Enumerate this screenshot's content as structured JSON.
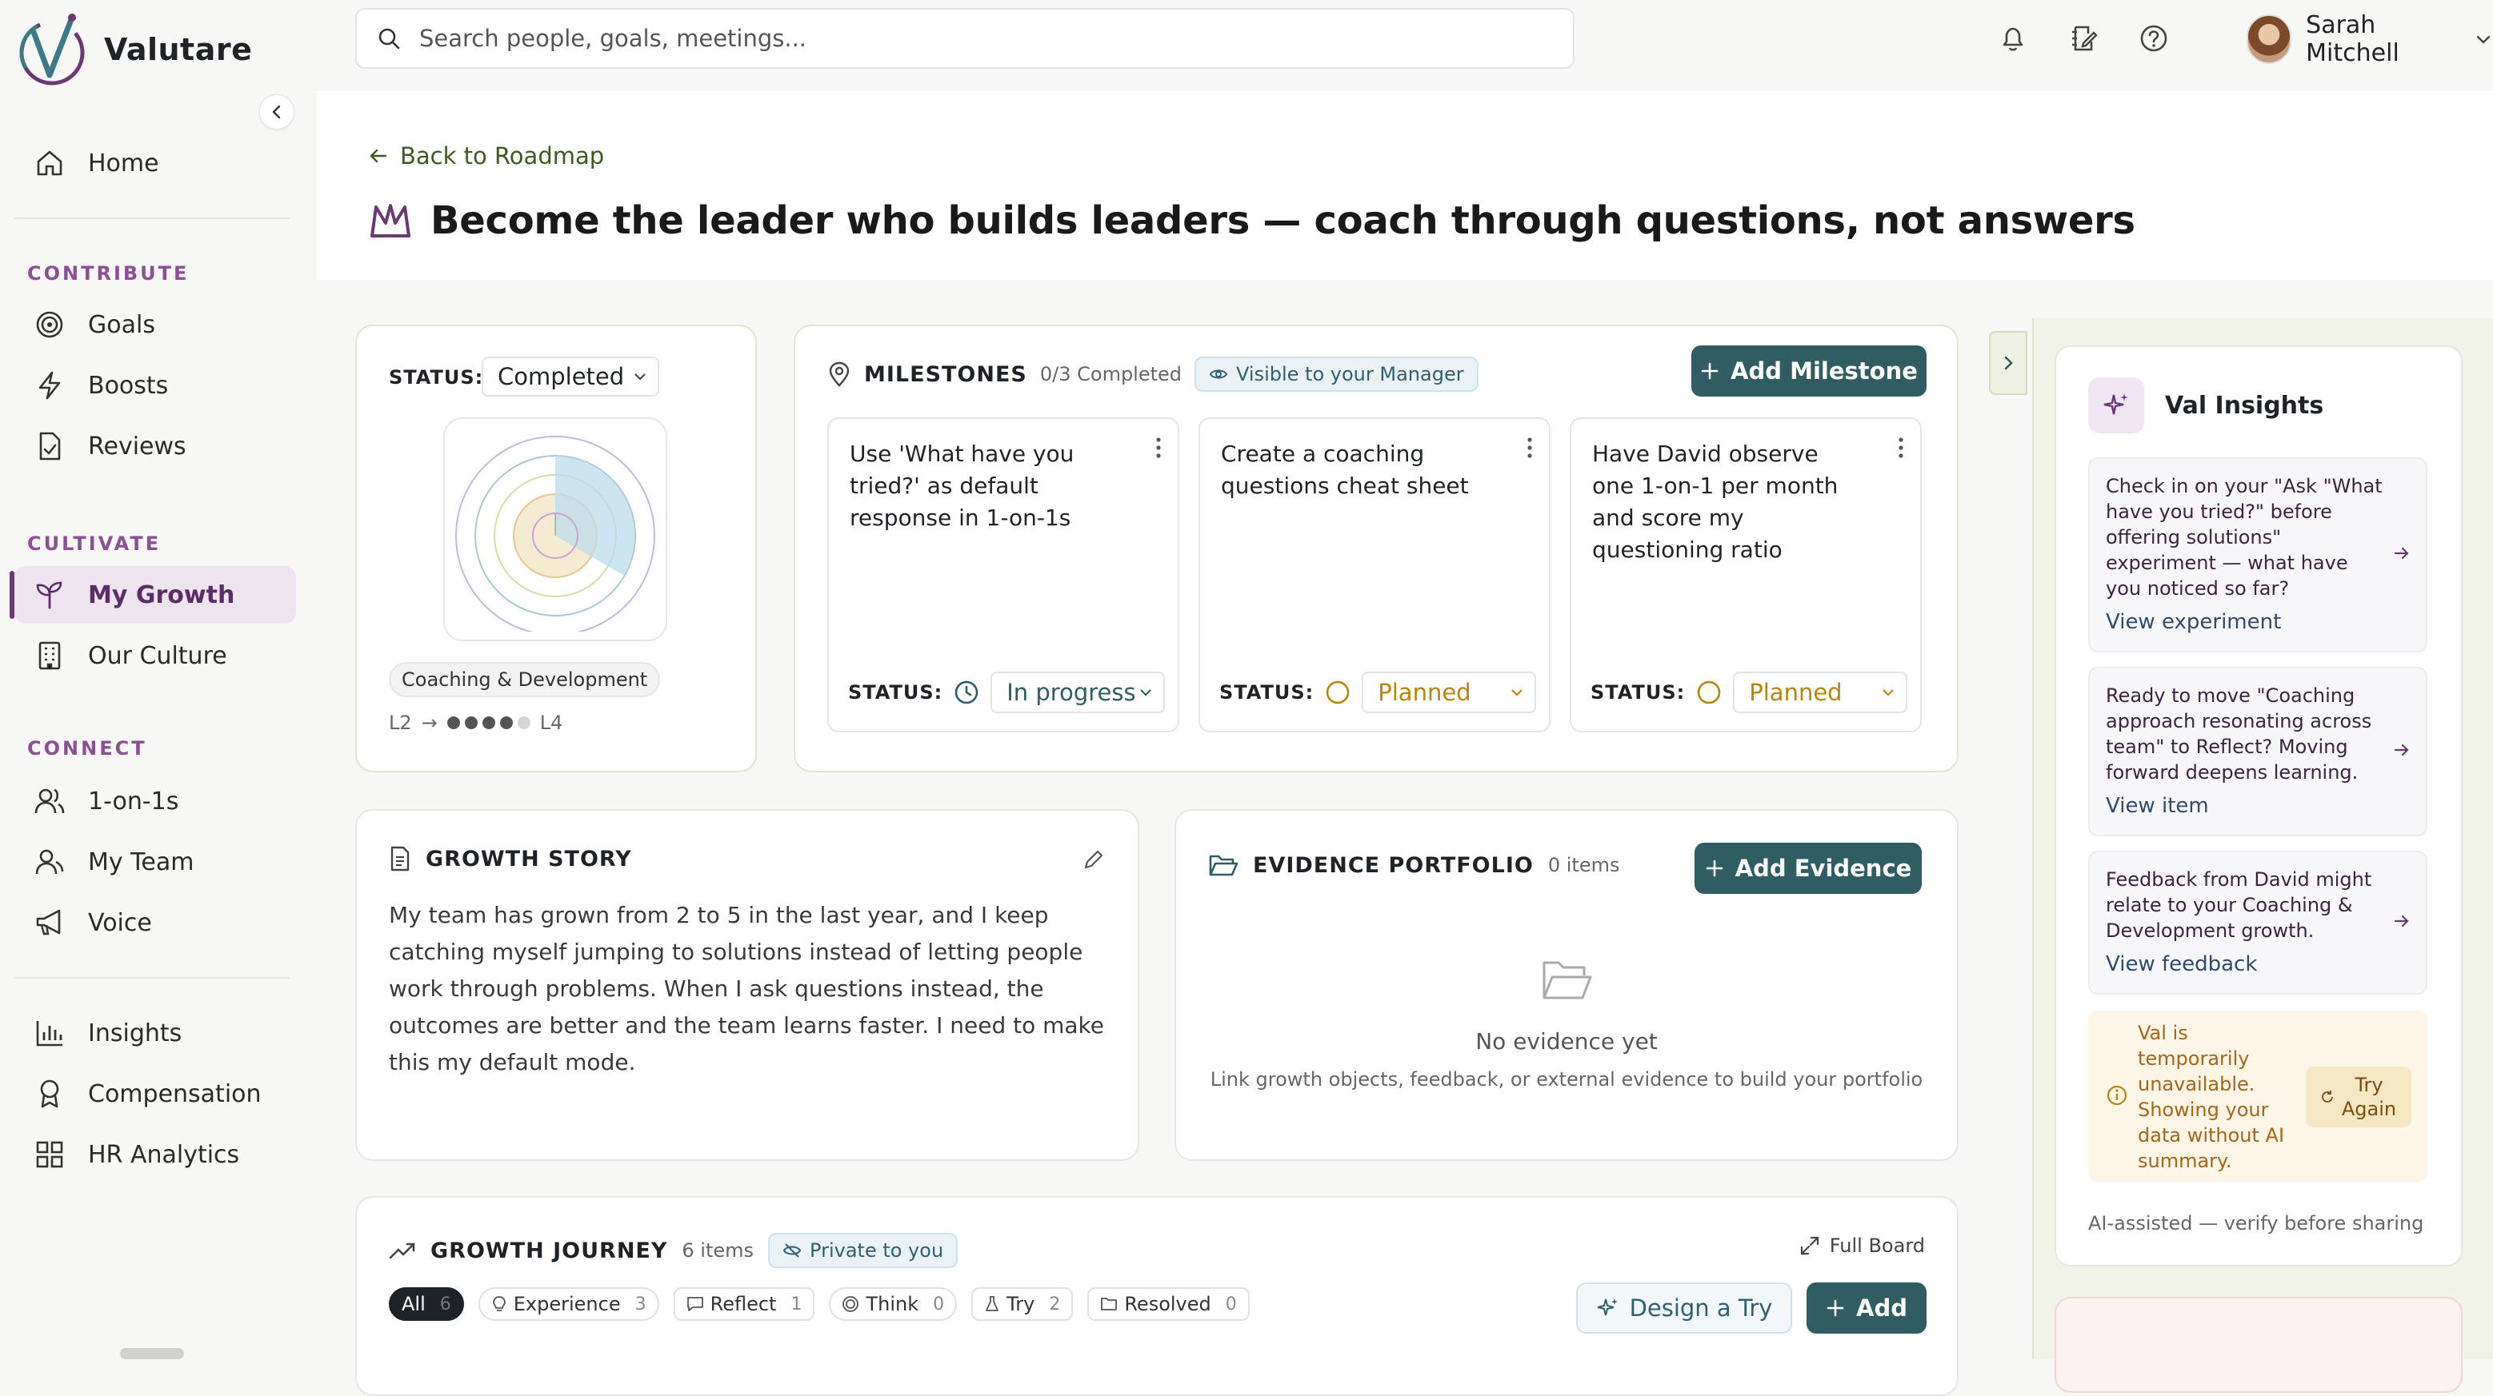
{
  "app": {
    "name": "Valutare"
  },
  "search": {
    "placeholder": "Search people, goals, meetings..."
  },
  "user": {
    "name": "Sarah Mitchell"
  },
  "sidebar": {
    "home": "Home",
    "sections": [
      {
        "label": "CONTRIBUTE",
        "items": [
          "Goals",
          "Boosts",
          "Reviews"
        ]
      },
      {
        "label": "CULTIVATE",
        "items": [
          "My Growth",
          "Our Culture"
        ]
      },
      {
        "label": "CONNECT",
        "items": [
          "1-on-1s",
          "My Team",
          "Voice"
        ]
      }
    ],
    "bottom": [
      "Insights",
      "Compensation",
      "HR Analytics"
    ]
  },
  "page": {
    "back_label": "Back to Roadmap",
    "title": "Become the leader who builds leaders — coach through questions, not answers"
  },
  "status_card": {
    "label": "STATUS:",
    "value": "Completed",
    "tag": "Coaching & Development",
    "level_from": "L2",
    "level_arrow": "→",
    "level_to": "L4",
    "level_filled": 4,
    "level_total": 5
  },
  "milestones": {
    "title": "MILESTONES",
    "count": "0/3 Completed",
    "visibility": "Visible to your Manager",
    "add_label": "Add Milestone",
    "status_label": "STATUS:",
    "items": [
      {
        "title": "Use 'What have you tried?' as default response in 1-on-1s",
        "status": "In progress"
      },
      {
        "title": "Create a coaching questions cheat sheet",
        "status": "Planned"
      },
      {
        "title": "Have David observe one 1-on-1 per month and score my questioning ratio",
        "status": "Planned"
      }
    ]
  },
  "growth_story": {
    "title": "GROWTH STORY",
    "text": "My team has grown from 2 to 5 in the last year, and I keep catching myself jumping to solutions instead of letting people work through problems. When I ask questions instead, the outcomes are better and the team learns faster. I need to make this my default mode."
  },
  "evidence": {
    "title": "EVIDENCE PORTFOLIO",
    "count": "0 items",
    "add_label": "Add Evidence",
    "empty_title": "No evidence yet",
    "empty_desc": "Link growth objects, feedback, or external evidence to build your portfolio"
  },
  "journey": {
    "title": "GROWTH JOURNEY",
    "count": "6 items",
    "privacy": "Private to you",
    "full_board": "Full Board",
    "design_label": "Design a Try",
    "add_label": "Add",
    "filters": [
      {
        "label": "All",
        "count": "6"
      },
      {
        "label": "Experience",
        "count": "3"
      },
      {
        "label": "Reflect",
        "count": "1"
      },
      {
        "label": "Think",
        "count": "0"
      },
      {
        "label": "Try",
        "count": "2"
      },
      {
        "label": "Resolved",
        "count": "0"
      }
    ]
  },
  "insights": {
    "title": "Val Insights",
    "items": [
      {
        "text": "Check in on your \"Ask \"What have you tried?\" before offering solutions\" experiment — what have you noticed so far?",
        "link": "View experiment"
      },
      {
        "text": "Ready to move \"Coaching approach resonating across team\" to Reflect? Moving forward deepens learning.",
        "link": "View item"
      },
      {
        "text": "Feedback from David might relate to your Coaching & Development growth.",
        "link": "View feedback"
      }
    ],
    "warning": "Val is temporarily unavailable. Showing your data without AI summary.",
    "retry_label": "Try Again",
    "footer": "AI-assisted — verify before sharing"
  },
  "colors": {
    "accent": "#6b3875",
    "teal": "#2f5d63",
    "planned": "#b8860b"
  }
}
